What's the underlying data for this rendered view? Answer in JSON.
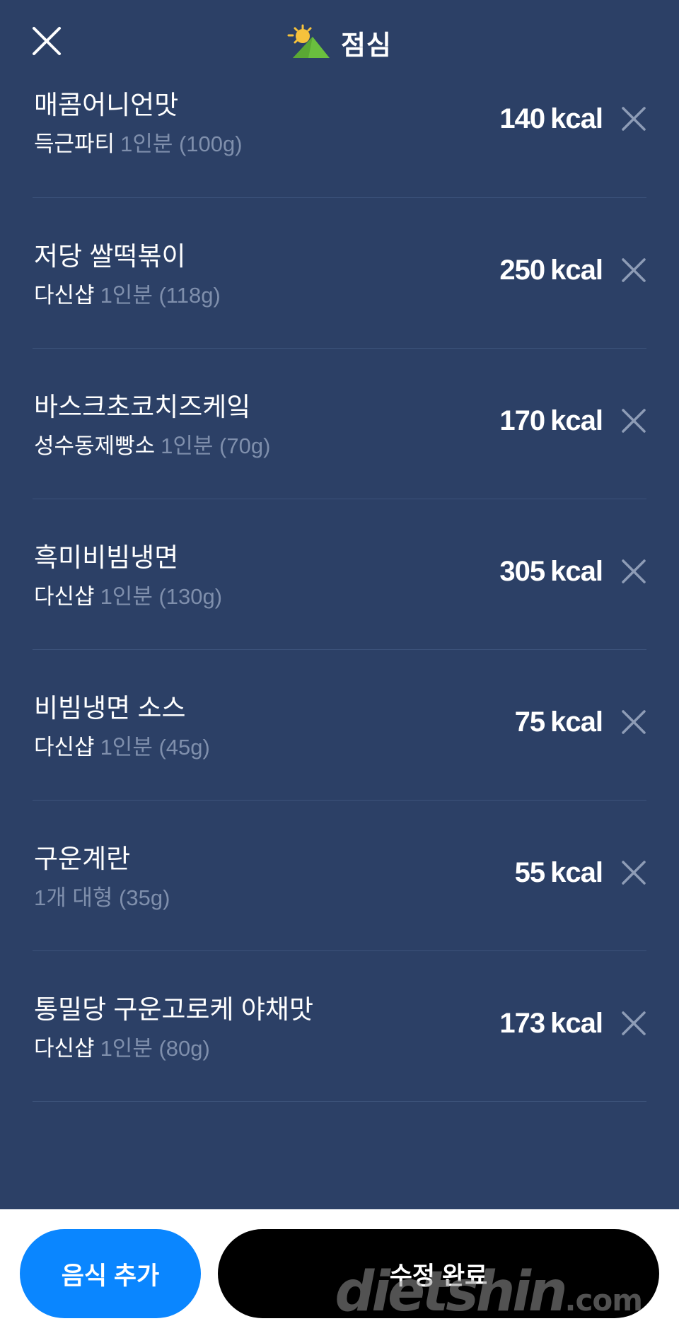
{
  "header": {
    "title": "점심",
    "close_icon": "close-icon",
    "meal_icon": "sun-behind-mountain-icon"
  },
  "items": [
    {
      "name": "매콤어니언맛",
      "brand": "득근파티",
      "serving": "1인분 (100g)",
      "kcal": "140",
      "unit": "kcal"
    },
    {
      "name": "저당 쌀떡볶이",
      "brand": "다신샵",
      "serving": "1인분 (118g)",
      "kcal": "250",
      "unit": "kcal"
    },
    {
      "name": "바스크초코치즈케잌",
      "brand": "성수동제빵소",
      "serving": "1인분 (70g)",
      "kcal": "170",
      "unit": "kcal"
    },
    {
      "name": "흑미비빔냉면",
      "brand": "다신샵",
      "serving": "1인분 (130g)",
      "kcal": "305",
      "unit": "kcal"
    },
    {
      "name": "비빔냉면 소스",
      "brand": "다신샵",
      "serving": "1인분 (45g)",
      "kcal": "75",
      "unit": "kcal"
    },
    {
      "name": "구운계란",
      "brand": "",
      "serving": "1개 대형 (35g)",
      "kcal": "55",
      "unit": "kcal"
    },
    {
      "name": "통밀당 구운고로케 야채맛",
      "brand": "다신샵",
      "serving": "1인분 (80g)",
      "kcal": "173",
      "unit": "kcal"
    }
  ],
  "footer": {
    "add_label": "음식 추가",
    "done_label": "수정 완료"
  },
  "watermark": {
    "main": "dietshin",
    "domain": ".com"
  },
  "colors": {
    "background": "#2c4066",
    "add_button": "#0a86ff",
    "done_button": "#000000",
    "muted_text": "#7f8fac"
  }
}
